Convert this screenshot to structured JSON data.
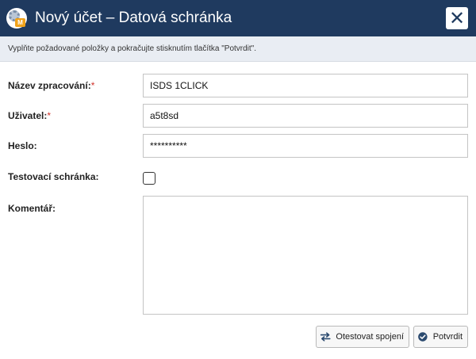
{
  "dialog": {
    "title": "Nový účet – Datová schránka",
    "close_symbol": "✕",
    "app_icon": "app-logo-icon",
    "app_icon_badge": "M"
  },
  "info": {
    "text": "Vyplňte požadované položky a pokračujte stisknutím tlačítka \"Potvrdit\"."
  },
  "form": {
    "nazev_label": "Název zpracování:",
    "nazev_required": "*",
    "nazev_value": "ISDS 1CLICK",
    "uzivatel_label": "Uživatel:",
    "uzivatel_required": "*",
    "uzivatel_value": "a5t8sd",
    "heslo_label": "Heslo:",
    "heslo_value": "**********",
    "testovaci_label": "Testovací schránka:",
    "testovaci_checked": false,
    "komentar_label": "Komentář:",
    "komentar_value": ""
  },
  "buttons": {
    "test_label": "Otestovat spojení",
    "test_icon": "swap-arrows-icon",
    "confirm_label": "Potvrdit",
    "confirm_icon": "check-circle-icon"
  },
  "colors": {
    "titlebar": "#1f3a5f",
    "infobar": "#e9edf3",
    "required": "#d0342c"
  }
}
